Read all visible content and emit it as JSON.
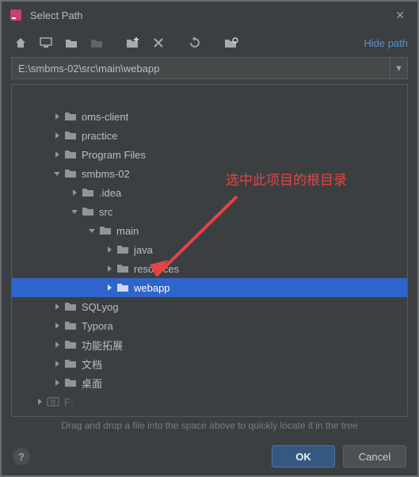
{
  "window": {
    "title": "Select Path",
    "hide_path": "Hide path",
    "path_value": "E:\\smbms-02\\src\\main\\webapp",
    "hint": "Drag and drop a file into the space above to quickly locate it in the tree"
  },
  "annotation": {
    "text": "选中此项目的根目录"
  },
  "tree": [
    {
      "label": "oms-client",
      "depth": 2,
      "has_children": true,
      "expanded": false
    },
    {
      "label": "practice",
      "depth": 2,
      "has_children": true,
      "expanded": false
    },
    {
      "label": "Program Files",
      "depth": 2,
      "has_children": true,
      "expanded": false
    },
    {
      "label": "smbms-02",
      "depth": 2,
      "has_children": true,
      "expanded": true
    },
    {
      "label": ".idea",
      "depth": 3,
      "has_children": true,
      "expanded": false
    },
    {
      "label": "src",
      "depth": 3,
      "has_children": true,
      "expanded": true
    },
    {
      "label": "main",
      "depth": 4,
      "has_children": true,
      "expanded": true
    },
    {
      "label": "java",
      "depth": 5,
      "has_children": true,
      "expanded": false
    },
    {
      "label": "resources",
      "depth": 5,
      "has_children": true,
      "expanded": false
    },
    {
      "label": "webapp",
      "depth": 5,
      "has_children": true,
      "expanded": false,
      "selected": true
    },
    {
      "label": "SQLyog",
      "depth": 2,
      "has_children": true,
      "expanded": false
    },
    {
      "label": "Typora",
      "depth": 2,
      "has_children": true,
      "expanded": false
    },
    {
      "label": "功能拓展",
      "depth": 2,
      "has_children": true,
      "expanded": false
    },
    {
      "label": "文档",
      "depth": 2,
      "has_children": true,
      "expanded": false
    },
    {
      "label": "桌面",
      "depth": 2,
      "has_children": true,
      "expanded": false
    },
    {
      "label": "F:",
      "depth": 1,
      "has_children": true,
      "expanded": false,
      "dim": true,
      "disk": true
    }
  ],
  "buttons": {
    "ok": "OK",
    "cancel": "Cancel"
  }
}
